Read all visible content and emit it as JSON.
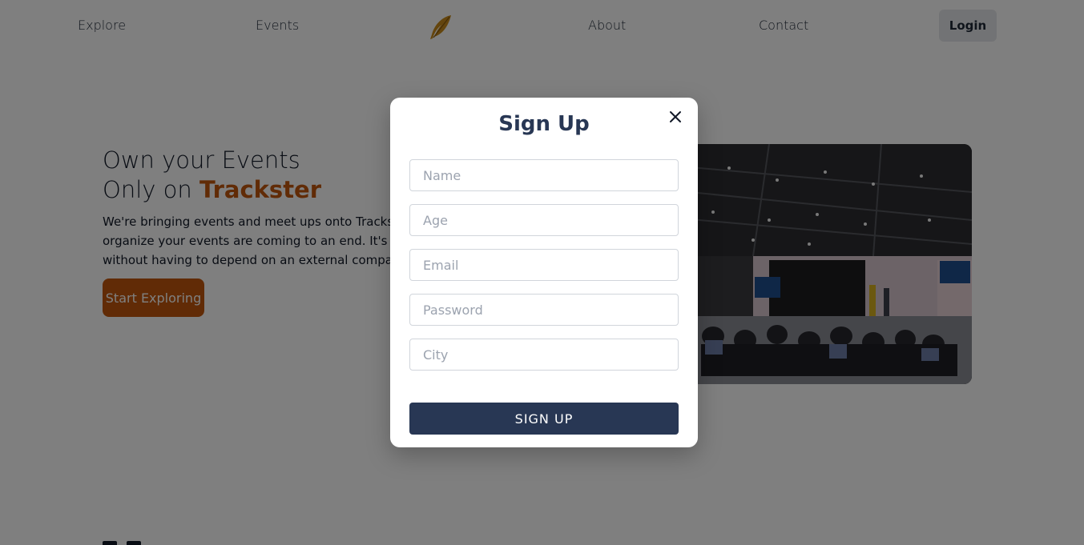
{
  "nav": {
    "explore": "Explore",
    "events": "Events",
    "about": "About",
    "contact": "Contact",
    "login": "Login"
  },
  "hero": {
    "title_line1": "Own your Events",
    "title_line2_prefix": "Only on ",
    "title_brand": "Trackster",
    "description": "We're bringing events and meet ups onto Trackster. The days of relying on another company to organize your events are coming to an end. It's time to truly own your events and communities without having to depend on an external company.",
    "cta": "Start Exploring"
  },
  "modal": {
    "title": "Sign Up",
    "fields": {
      "name_placeholder": "Name",
      "age_placeholder": "Age",
      "email_placeholder": "Email",
      "password_placeholder": "Password",
      "city_placeholder": "City"
    },
    "submit": "SIGN UP"
  },
  "colors": {
    "brand_orange": "#c2570c",
    "modal_navy": "#283754",
    "overlay": "rgba(0,0,0,0.5)"
  },
  "icons": {
    "logo": "feather-icon",
    "close": "close-icon"
  }
}
